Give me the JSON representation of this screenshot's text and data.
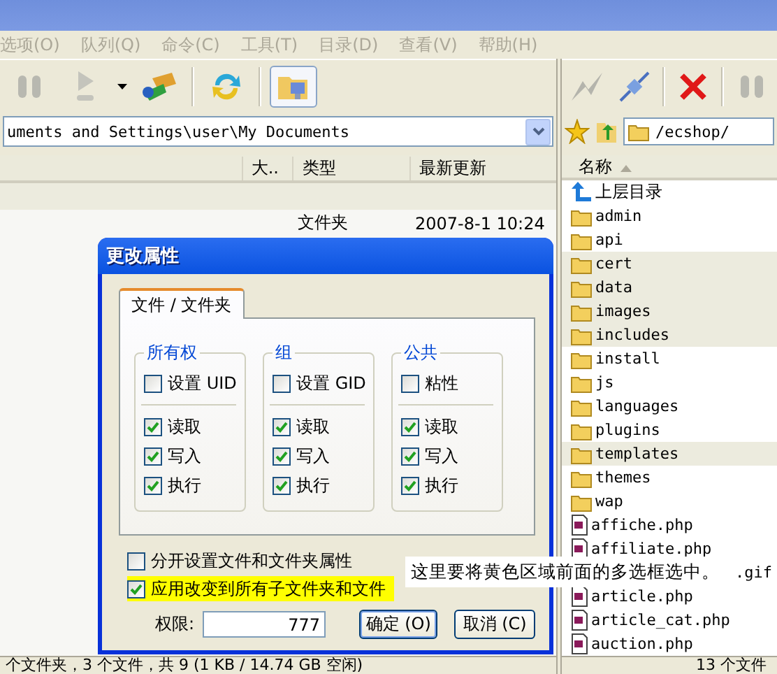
{
  "menu": [
    {
      "label": "选项(O)",
      "disabled": true
    },
    {
      "label": "队列(Q)",
      "disabled": true
    },
    {
      "label": "命令(C)",
      "disabled": true
    },
    {
      "label": "工具(T)",
      "disabled": true
    },
    {
      "label": "目录(D)",
      "disabled": true
    },
    {
      "label": "查看(V)",
      "disabled": true
    },
    {
      "label": "帮助(H)",
      "disabled": true
    }
  ],
  "left_toolbar": [
    {
      "kind": "pause",
      "pressed": false
    },
    {
      "kind": "go",
      "pressed": false
    },
    {
      "kind": "transfer",
      "pressed": false
    },
    {
      "kind": "refresh",
      "pressed": false
    },
    {
      "kind": "folder-network",
      "pressed": true
    }
  ],
  "right_toolbar": [
    {
      "kind": "bolt",
      "pressed": false
    },
    {
      "kind": "plug",
      "pressed": false
    },
    {
      "kind": "close",
      "pressed": false
    },
    {
      "kind": "pause",
      "pressed": false
    }
  ],
  "left_panel": {
    "path": "uments and Settings\\user\\My Documents",
    "columns": [
      "大..",
      "类型",
      "最新更新"
    ],
    "rows": [
      {
        "type": "文件夹",
        "modified": "2007-8-1 10:24"
      }
    ],
    "status": "个文件夹，3 个文件，共 9 (1 KB / 14.74 GB 空闲)"
  },
  "right_panel": {
    "path": "/ecshop/",
    "column": "名称",
    "items": [
      {
        "name": "上层目录",
        "kind": "up",
        "highlighted": false
      },
      {
        "name": "admin",
        "kind": "folder",
        "highlighted": false
      },
      {
        "name": "api",
        "kind": "folder",
        "highlighted": false
      },
      {
        "name": "cert",
        "kind": "folder",
        "highlighted": true
      },
      {
        "name": "data",
        "kind": "folder",
        "highlighted": true
      },
      {
        "name": "images",
        "kind": "folder",
        "highlighted": true
      },
      {
        "name": "includes",
        "kind": "folder",
        "highlighted": true
      },
      {
        "name": "install",
        "kind": "folder",
        "highlighted": false
      },
      {
        "name": "js",
        "kind": "folder",
        "highlighted": false
      },
      {
        "name": "languages",
        "kind": "folder",
        "highlighted": false
      },
      {
        "name": "plugins",
        "kind": "folder",
        "highlighted": false
      },
      {
        "name": "templates",
        "kind": "folder",
        "highlighted": true
      },
      {
        "name": "themes",
        "kind": "folder",
        "highlighted": false
      },
      {
        "name": "wap",
        "kind": "folder",
        "highlighted": false
      },
      {
        "name": "affiche.php",
        "kind": "file",
        "highlighted": false
      },
      {
        "name": "affiliate.php",
        "kind": "file",
        "highlighted": false
      },
      {
        "name": ".gif",
        "kind": "covered",
        "highlighted": false
      },
      {
        "name": "article.php",
        "kind": "file",
        "highlighted": false
      },
      {
        "name": "article_cat.php",
        "kind": "file",
        "highlighted": false
      },
      {
        "name": "auction.php",
        "kind": "file",
        "highlighted": false
      }
    ],
    "status": "13 个文件"
  },
  "dialog": {
    "title": "更改属性",
    "tab": "文件 / 文件夹",
    "groups": [
      {
        "title": "所有权",
        "special": {
          "label": "设置 UID",
          "checked": false
        },
        "perms": [
          {
            "label": "读取",
            "checked": true
          },
          {
            "label": "写入",
            "checked": true
          },
          {
            "label": "执行",
            "checked": true
          }
        ]
      },
      {
        "title": "组",
        "special": {
          "label": "设置 GID",
          "checked": false
        },
        "perms": [
          {
            "label": "读取",
            "checked": true
          },
          {
            "label": "写入",
            "checked": true
          },
          {
            "label": "执行",
            "checked": true
          }
        ]
      },
      {
        "title": "公共",
        "special": {
          "label": "粘性",
          "checked": false
        },
        "perms": [
          {
            "label": "读取",
            "checked": true
          },
          {
            "label": "写入",
            "checked": true
          },
          {
            "label": "执行",
            "checked": true
          }
        ]
      }
    ],
    "options": [
      {
        "label": "分开设置文件和文件夹属性",
        "checked": false,
        "highlighted": false
      },
      {
        "label": "应用改变到所有子文件夹和文件",
        "checked": true,
        "highlighted": true
      }
    ],
    "permission_label": "权限:",
    "permission_value": "777",
    "ok": "确定 (O)",
    "cancel": "取消 (C)"
  },
  "note": "这里要将黄色区域前面的多选框选中。"
}
